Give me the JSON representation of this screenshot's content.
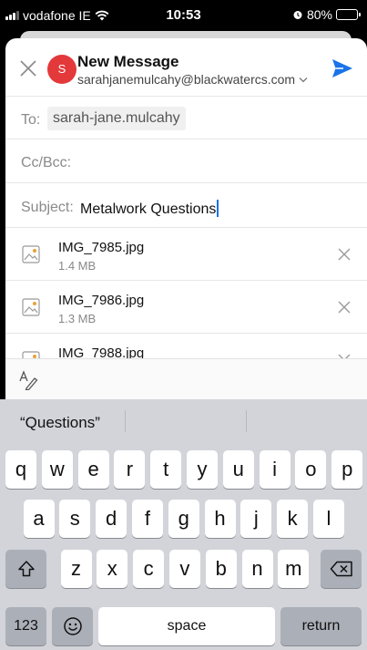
{
  "status_bar": {
    "carrier": "vodafone IE",
    "time": "10:53",
    "battery": "80%",
    "battery_level": 0.8
  },
  "compose": {
    "title": "New Message",
    "from_address": "sarahjanemulcahy@blackwatercs.com",
    "avatar_initial": "S",
    "to_label": "To:",
    "to_recipient": "sarah-jane.mulcahy",
    "cc_label": "Cc/Bcc:",
    "subject_label": "Subject:",
    "subject_value": "Metalwork Questions",
    "accent_color": "#1a73e8",
    "avatar_color": "#e3393a"
  },
  "attachments": [
    {
      "name": "IMG_7985.jpg",
      "size": "1.4 MB"
    },
    {
      "name": "IMG_7986.jpg",
      "size": "1.3 MB"
    },
    {
      "name": "IMG_7988.jpg",
      "size": ""
    }
  ],
  "keyboard": {
    "suggestion": "“Questions”",
    "row1": [
      "q",
      "w",
      "e",
      "r",
      "t",
      "y",
      "u",
      "i",
      "o",
      "p"
    ],
    "row2": [
      "a",
      "s",
      "d",
      "f",
      "g",
      "h",
      "j",
      "k",
      "l"
    ],
    "row3": [
      "z",
      "x",
      "c",
      "v",
      "b",
      "n",
      "m"
    ],
    "numbers_label": "123",
    "space_label": "space",
    "return_label": "return"
  }
}
